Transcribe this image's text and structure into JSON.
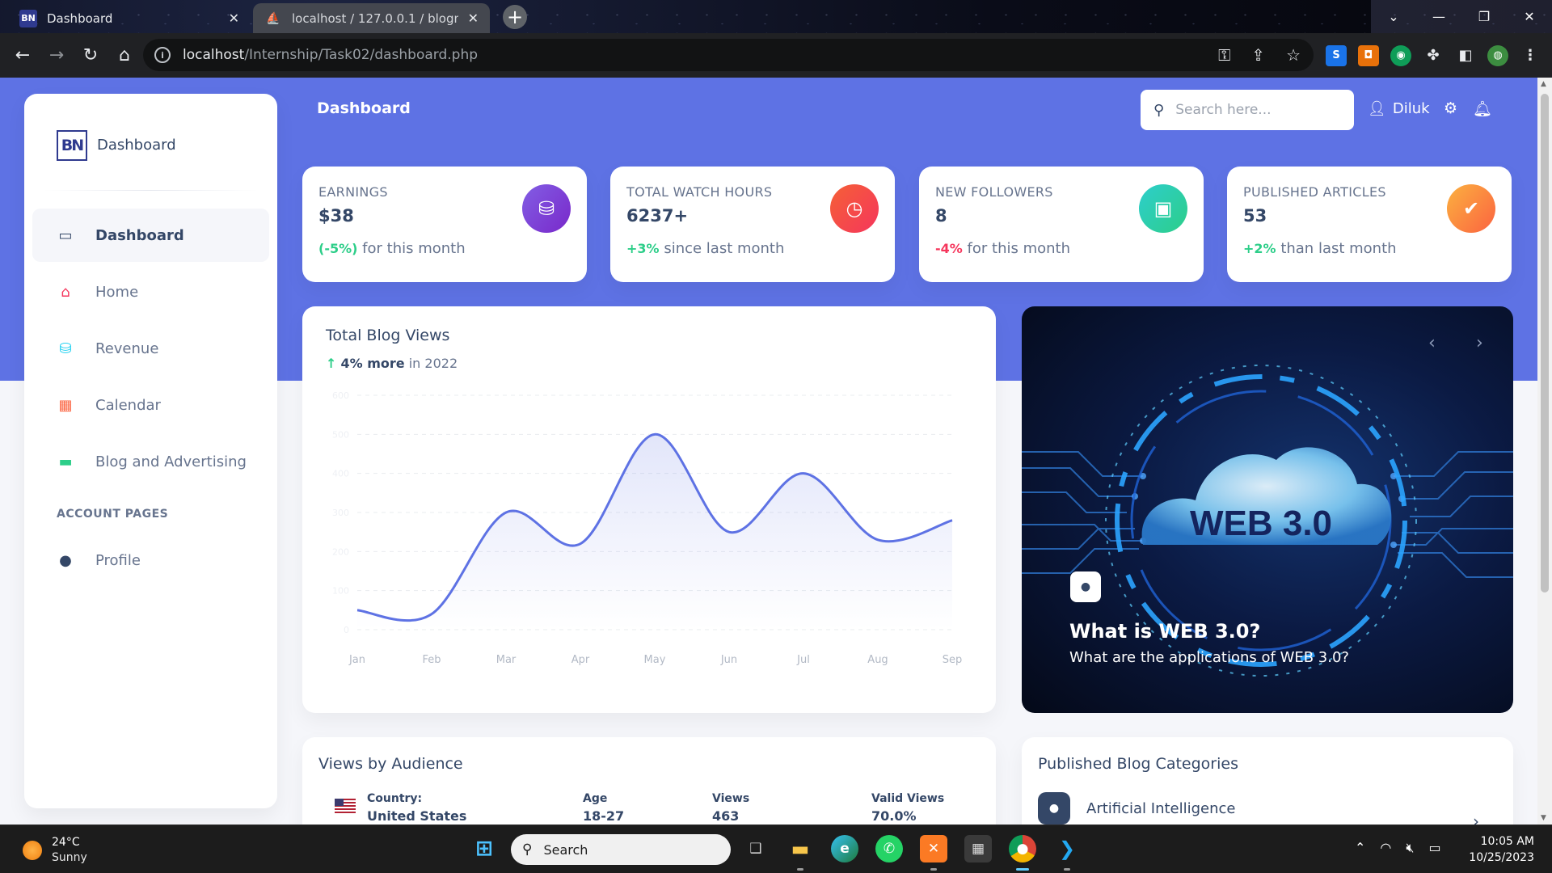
{
  "browser": {
    "tabs": [
      {
        "title": "Dashboard",
        "favicon": "BN"
      },
      {
        "title": "localhost / 127.0.0.1 / blogner /",
        "favicon": "pma"
      }
    ],
    "url_host": "localhost",
    "url_path": "/Internship/Task02/dashboard.php"
  },
  "sidebar": {
    "brand": "Dashboard",
    "brand_logo": "BN",
    "items": [
      {
        "label": "Dashboard",
        "icon": "monitor-icon",
        "color": "#344767"
      },
      {
        "label": "Home",
        "icon": "home-icon",
        "color": "#f5365c"
      },
      {
        "label": "Revenue",
        "icon": "coins-icon",
        "color": "#11cdef"
      },
      {
        "label": "Calendar",
        "icon": "calendar-icon",
        "color": "#fb6340"
      },
      {
        "label": "Blog and Advertising",
        "icon": "credit-card-icon",
        "color": "#2dce89"
      }
    ],
    "section_title": "ACCOUNT PAGES",
    "account_items": [
      {
        "label": "Profile",
        "icon": "user-icon"
      }
    ]
  },
  "header": {
    "title": "Dashboard",
    "search_placeholder": "Search here...",
    "user": "Diluk"
  },
  "stats": [
    {
      "label": "EARNINGS",
      "value": "$38",
      "change": "(-5%)",
      "suffix": "for this month",
      "trend": "up",
      "icon": "coins-icon",
      "color": "#825ee4"
    },
    {
      "label": "TOTAL WATCH HOURS",
      "value": "6237+",
      "change": "+3%",
      "suffix": "since last month",
      "trend": "up",
      "icon": "clock-icon",
      "color": "#f5365c"
    },
    {
      "label": "NEW FOLLOWERS",
      "value": "8",
      "change": "-4%",
      "suffix": "for this month",
      "trend": "down",
      "icon": "user-card-icon",
      "color": "#2dce89"
    },
    {
      "label": "PUBLISHED ARTICLES",
      "value": "53",
      "change": "+2%",
      "suffix": "than last month",
      "trend": "up",
      "icon": "check-icon",
      "color": "#fb6340"
    }
  ],
  "blog_views": {
    "title": "Total Blog Views",
    "highlight": "4% more",
    "period": "in 2022"
  },
  "chart_data": {
    "type": "line",
    "title": "Total Blog Views",
    "categories": [
      "Jan",
      "Feb",
      "Mar",
      "Apr",
      "May",
      "Jun",
      "Jul",
      "Aug",
      "Sep"
    ],
    "values": [
      50,
      40,
      300,
      220,
      500,
      250,
      400,
      230,
      280
    ],
    "ylim": [
      0,
      600
    ],
    "gridlines": [
      0,
      100,
      200,
      300,
      400,
      500,
      600
    ],
    "line_color": "#5e72e4",
    "grid": true,
    "fill": "gradient"
  },
  "carousel": {
    "image_text": "WEB 3.0",
    "title": "What is WEB 3.0?",
    "subtitle": "What are the applications of WEB 3.0?"
  },
  "audience": {
    "title": "Views by Audience",
    "headers": [
      "Country:",
      "Age",
      "Views",
      "Valid Views"
    ],
    "rows": [
      {
        "country": "United States",
        "age": "18-27",
        "views": "463",
        "valid": "70.0%"
      }
    ]
  },
  "categories": {
    "title": "Published Blog Categories",
    "items": [
      {
        "name": "Artificial Intelligence"
      }
    ]
  },
  "taskbar": {
    "temperature": "24°C",
    "weather": "Sunny",
    "search": "Search",
    "time": "10:05 AM",
    "date": "10/25/2023"
  }
}
